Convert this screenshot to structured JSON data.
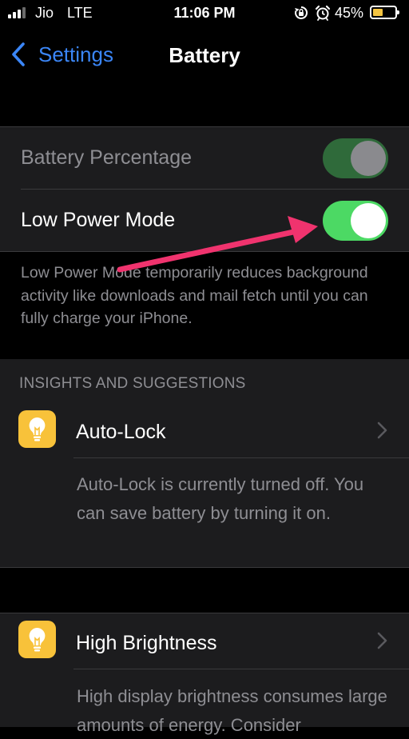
{
  "status_bar": {
    "carrier": "Jio",
    "network": "LTE",
    "time": "11:06 PM",
    "battery_percent": "45%",
    "battery_level": 0.45,
    "signal_bars": 3,
    "signal_bars_total": 4,
    "icons": [
      "orientation-lock-icon",
      "alarm-icon",
      "battery-icon"
    ]
  },
  "nav": {
    "back_label": "Settings",
    "title": "Battery"
  },
  "settings": {
    "battery_percentage": {
      "label": "Battery Percentage",
      "on": true,
      "enabled": false
    },
    "low_power_mode": {
      "label": "Low Power Mode",
      "on": true
    },
    "footer": "Low Power Mode temporarily reduces background activity like downloads and mail fetch until you can fully charge your iPhone."
  },
  "insights": {
    "header": "INSIGHTS AND SUGGESTIONS",
    "cards": [
      {
        "title": "Auto-Lock",
        "icon": "lightbulb-icon",
        "description": "Auto-Lock is currently turned off. You can save battery by turning it on."
      },
      {
        "title": "High Brightness",
        "icon": "lightbulb-icon",
        "description": "High display brightness consumes large amounts of energy. Consider"
      }
    ]
  },
  "colors": {
    "accent": "#3b86f7",
    "toggle_on": "#4cd964",
    "toggle_disabled": "#2f6a3a",
    "annotation_arrow": "#f0336e",
    "icon_bg": "#f8c23a"
  }
}
